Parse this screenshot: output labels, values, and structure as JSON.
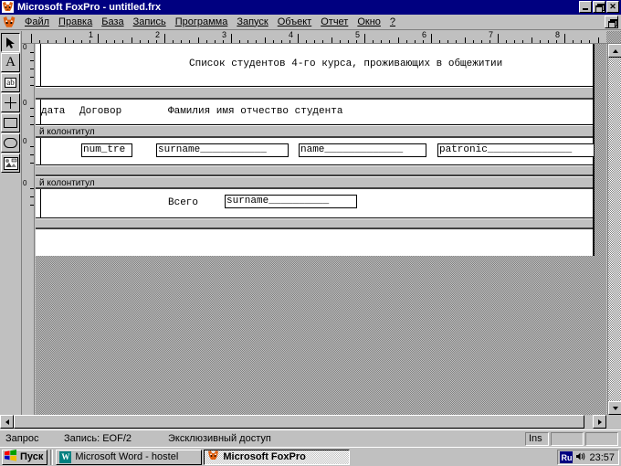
{
  "window": {
    "title": "Microsoft FoxPro - untitled.frx",
    "icon": "foxpro-icon",
    "minimize_label": "",
    "restore_label": "",
    "close_label": "✕"
  },
  "menubar": {
    "items": [
      {
        "label": "Файл"
      },
      {
        "label": "Правка"
      },
      {
        "label": "База"
      },
      {
        "label": "Запись"
      },
      {
        "label": "Программа"
      },
      {
        "label": "Запуск"
      },
      {
        "label": "Объект"
      },
      {
        "label": "Отчет"
      },
      {
        "label": "Окно"
      },
      {
        "label": "?"
      }
    ]
  },
  "toolbox": {
    "items": [
      {
        "name": "select-pointer-tool",
        "glyph": "arrow"
      },
      {
        "name": "label-tool",
        "glyph": "A"
      },
      {
        "name": "field-tool",
        "glyph": "ab"
      },
      {
        "name": "line-tool",
        "glyph": "plus"
      },
      {
        "name": "rectangle-tool",
        "glyph": "rect"
      },
      {
        "name": "rounded-rectangle-tool",
        "glyph": "round"
      },
      {
        "name": "picture-ole-tool",
        "glyph": "picture"
      }
    ]
  },
  "ruler": {
    "horizontal_numbers": [
      "1",
      "2",
      "3",
      "4",
      "5",
      "6",
      "7",
      "8"
    ],
    "vertical_marks": [
      "0",
      "0",
      "0",
      "0"
    ]
  },
  "report": {
    "bands": [
      {
        "name": "title-band",
        "separator_label": "",
        "vruler_zero": "0",
        "elements": [
          {
            "type": "text",
            "name": "report-title",
            "value": "Список студентов 4-го курса, проживающих в общежитии"
          }
        ]
      },
      {
        "name": "column-header-band",
        "separator_label": "",
        "vruler_zero": "0",
        "elements": [
          {
            "type": "text",
            "name": "col-header-date",
            "value": "дата"
          },
          {
            "type": "text",
            "name": "col-header-contract",
            "value": "Договор"
          },
          {
            "type": "text",
            "name": "col-header-fullname",
            "value": "Фамилия имя отчество студента"
          }
        ]
      },
      {
        "name": "detail-band",
        "separator_label": "й колонтитул",
        "vruler_zero": "0",
        "elements": [
          {
            "type": "field",
            "name": "field-num-tre",
            "value": "num_tre"
          },
          {
            "type": "field",
            "name": "field-surname",
            "value": "surname___________"
          },
          {
            "type": "field",
            "name": "field-name",
            "value": "name_____________"
          },
          {
            "type": "field",
            "name": "field-patronic",
            "value": "patronic______________"
          }
        ]
      },
      {
        "name": "summary-band",
        "separator_label": "й колонтитул",
        "vruler_zero": "0",
        "elements": [
          {
            "type": "text",
            "name": "total-label",
            "value": "Всего"
          },
          {
            "type": "field",
            "name": "field-total-surname",
            "value": "surname__________"
          }
        ]
      }
    ]
  },
  "statusbar": {
    "mode": "Запрос",
    "record": "Запись: EOF/2",
    "access": "Эксклюзивный доступ",
    "insert_mode": "Ins",
    "cell4": "",
    "cell5": ""
  },
  "taskbar": {
    "start_label": "Пуск",
    "tasks": [
      {
        "label": "Microsoft Word - hostel",
        "icon": "word-icon",
        "active": false
      },
      {
        "label": "Microsoft FoxPro",
        "icon": "foxpro-icon",
        "active": true
      }
    ],
    "tray": {
      "language": "Ru",
      "speaker_icon": "speaker-icon",
      "clock": "23:57"
    }
  },
  "colors": {
    "titlebar": "#000080",
    "face": "#c0c0c0",
    "canvas": "#ffffff",
    "accent": "#000080"
  }
}
